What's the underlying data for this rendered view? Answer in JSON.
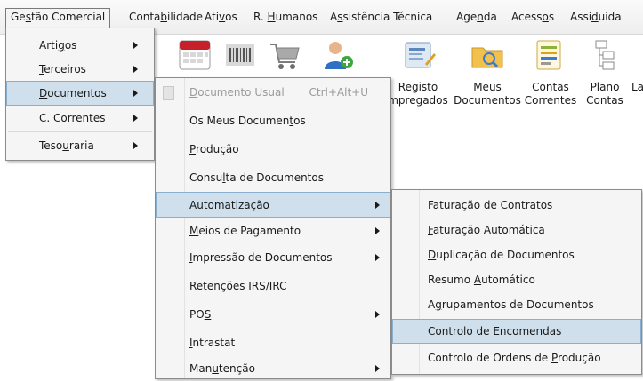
{
  "menubar": {
    "items": [
      {
        "label": "Gestão Comercial"
      },
      {
        "label": "Contabilidade"
      },
      {
        "label": "Ativos"
      },
      {
        "label": "R. Humanos"
      },
      {
        "label": "Assistência Técnica"
      },
      {
        "label": "Agenda"
      },
      {
        "label": "Acessos"
      },
      {
        "label": "Assiduida"
      }
    ]
  },
  "ribbon": {
    "buttons": [
      {
        "icon": "calendar-icon",
        "line1": "",
        "line2": ""
      },
      {
        "icon": "barcode-icon",
        "line1": "",
        "line2": ""
      },
      {
        "icon": "shopping-cart-icon",
        "line1": "",
        "line2": ""
      },
      {
        "icon": "add-user-icon",
        "line1": "",
        "line2": ""
      },
      {
        "icon": "register-employees-icon",
        "line1": "Registo",
        "line2": "mpregados"
      },
      {
        "icon": "my-documents-icon",
        "line1": "Meus",
        "line2": "Documentos"
      },
      {
        "icon": "current-accounts-icon",
        "line1": "Contas",
        "line2": "Correntes"
      },
      {
        "icon": "chart-of-accounts-icon",
        "line1": "Plano",
        "line2": "Contas"
      },
      {
        "icon": "",
        "line1": "La",
        "line2": ""
      }
    ]
  },
  "menu_gestao": {
    "items": [
      {
        "label": "Artigos",
        "submenu": true
      },
      {
        "label": "Terceiros",
        "submenu": true
      },
      {
        "label": "Documentos",
        "submenu": true,
        "highlighted": true
      },
      {
        "label": "C. Correntes",
        "submenu": true
      },
      {
        "label": "Tesouraria",
        "submenu": true
      }
    ]
  },
  "menu_documentos": {
    "items": [
      {
        "label": "Documento Usual",
        "shortcut": "Ctrl+Alt+U",
        "disabled": true
      },
      {
        "label": "Os Meus Documentos"
      },
      {
        "label": "Produção"
      },
      {
        "label": "Consulta de Documentos"
      },
      {
        "label": "Automatização",
        "submenu": true,
        "highlighted": true
      },
      {
        "label": "Meios de Pagamento",
        "submenu": true
      },
      {
        "label": "Impressão de Documentos",
        "submenu": true
      },
      {
        "label": "Retenções IRS/IRC"
      },
      {
        "label": "POS",
        "submenu": true
      },
      {
        "label": "Intrastat"
      },
      {
        "label": "Manutenção",
        "submenu": true
      }
    ]
  },
  "menu_automatizacao": {
    "items": [
      {
        "label": "Faturação de Contratos"
      },
      {
        "label": "Faturação Automática"
      },
      {
        "label": "Duplicação de Documentos"
      },
      {
        "label": "Resumo Automático"
      },
      {
        "label": "Agrupamentos de Documentos"
      },
      {
        "label": "Controlo de Encomendas",
        "highlighted": true
      },
      {
        "label": "Controlo de Ordens de Produção"
      }
    ]
  },
  "colors": {
    "highlight_bg": "#cfdfec",
    "highlight_border": "#8aaecd",
    "menu_bg": "#f5f5f5"
  }
}
